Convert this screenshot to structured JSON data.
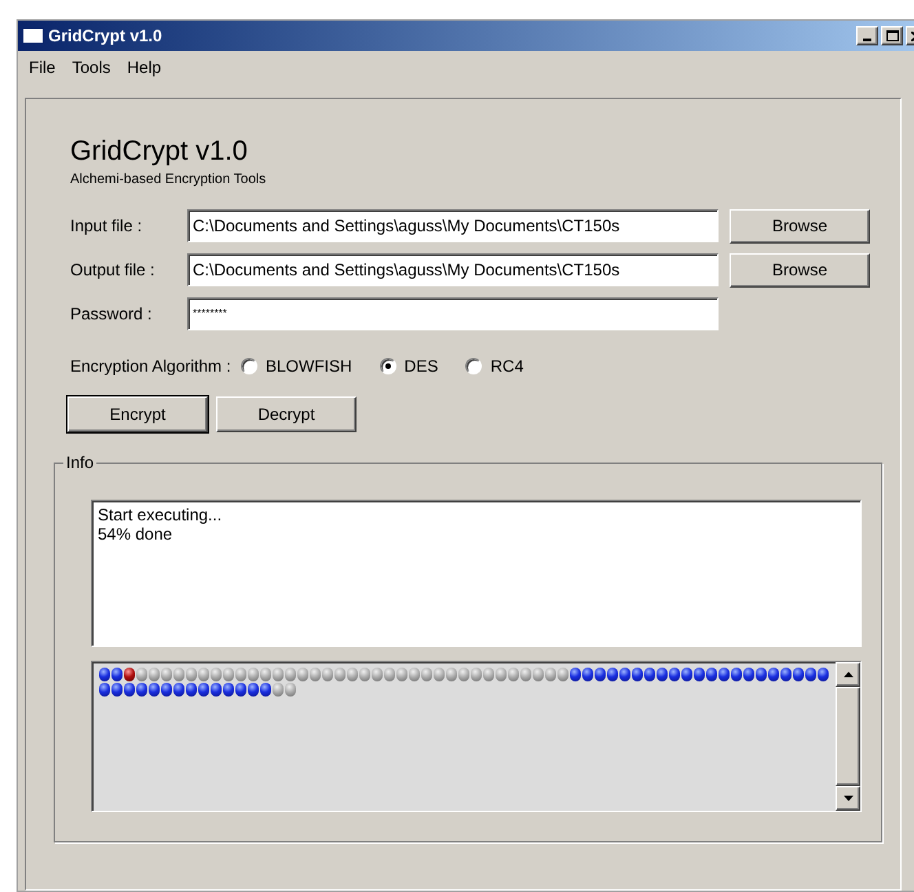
{
  "window": {
    "title": "GridCrypt v1.0"
  },
  "menu": [
    "File",
    "Tools",
    "Help"
  ],
  "header": {
    "title": "GridCrypt v1.0",
    "subtitle": "Alchemi-based Encryption Tools"
  },
  "fields": [
    {
      "label": "Input file :",
      "value": "C:\\Documents and Settings\\aguss\\My Documents\\CT150s",
      "button": "Browse"
    },
    {
      "label": "Output file :",
      "value": "C:\\Documents and Settings\\aguss\\My Documents\\CT150s",
      "button": "Browse"
    },
    {
      "label": "Password :",
      "value": "********"
    }
  ],
  "algorithm": {
    "label": "Encryption Algorithm :",
    "options": [
      {
        "label": "BLOWFISH",
        "selected": false
      },
      {
        "label": "DES",
        "selected": true
      },
      {
        "label": "RC4",
        "selected": false
      }
    ]
  },
  "actions": [
    {
      "label": "Encrypt",
      "default": true
    },
    {
      "label": "Decrypt",
      "default": false
    }
  ],
  "info": {
    "title": "Info",
    "log": [
      "Start executing...",
      "54% done"
    ],
    "nodes": [
      {
        "kind": "done"
      },
      {
        "kind": "done"
      },
      {
        "kind": "failed"
      },
      {
        "kind": "idle"
      },
      {
        "kind": "idle"
      },
      {
        "kind": "idle"
      },
      {
        "kind": "idle"
      },
      {
        "kind": "idle"
      },
      {
        "kind": "idle"
      },
      {
        "kind": "idle"
      },
      {
        "kind": "idle"
      },
      {
        "kind": "idle"
      },
      {
        "kind": "idle"
      },
      {
        "kind": "idle"
      },
      {
        "kind": "idle"
      },
      {
        "kind": "idle"
      },
      {
        "kind": "idle"
      },
      {
        "kind": "idle"
      },
      {
        "kind": "idle"
      },
      {
        "kind": "idle"
      },
      {
        "kind": "idle"
      },
      {
        "kind": "idle"
      },
      {
        "kind": "idle"
      },
      {
        "kind": "idle"
      },
      {
        "kind": "idle"
      },
      {
        "kind": "idle"
      },
      {
        "kind": "idle"
      },
      {
        "kind": "idle"
      },
      {
        "kind": "idle"
      },
      {
        "kind": "idle"
      },
      {
        "kind": "idle"
      },
      {
        "kind": "idle"
      },
      {
        "kind": "idle"
      },
      {
        "kind": "idle"
      },
      {
        "kind": "idle"
      },
      {
        "kind": "idle"
      },
      {
        "kind": "idle"
      },
      {
        "kind": "idle"
      },
      {
        "kind": "done"
      },
      {
        "kind": "done"
      },
      {
        "kind": "done"
      },
      {
        "kind": "done"
      },
      {
        "kind": "done"
      },
      {
        "kind": "done"
      },
      {
        "kind": "done"
      },
      {
        "kind": "done"
      },
      {
        "kind": "done"
      },
      {
        "kind": "done"
      },
      {
        "kind": "done"
      },
      {
        "kind": "done"
      },
      {
        "kind": "done"
      },
      {
        "kind": "done"
      },
      {
        "kind": "done"
      },
      {
        "kind": "done"
      },
      {
        "kind": "done"
      },
      {
        "kind": "done"
      },
      {
        "kind": "done"
      },
      {
        "kind": "done"
      },
      {
        "kind": "done"
      },
      {
        "kind": "done"
      },
      {
        "kind": "done"
      },
      {
        "kind": "done"
      },
      {
        "kind": "done"
      },
      {
        "kind": "done"
      },
      {
        "kind": "done"
      },
      {
        "kind": "done"
      },
      {
        "kind": "done"
      },
      {
        "kind": "done"
      },
      {
        "kind": "done"
      },
      {
        "kind": "done"
      },
      {
        "kind": "done"
      },
      {
        "kind": "done"
      },
      {
        "kind": "done"
      },
      {
        "kind": "idle"
      },
      {
        "kind": "idle"
      }
    ]
  }
}
